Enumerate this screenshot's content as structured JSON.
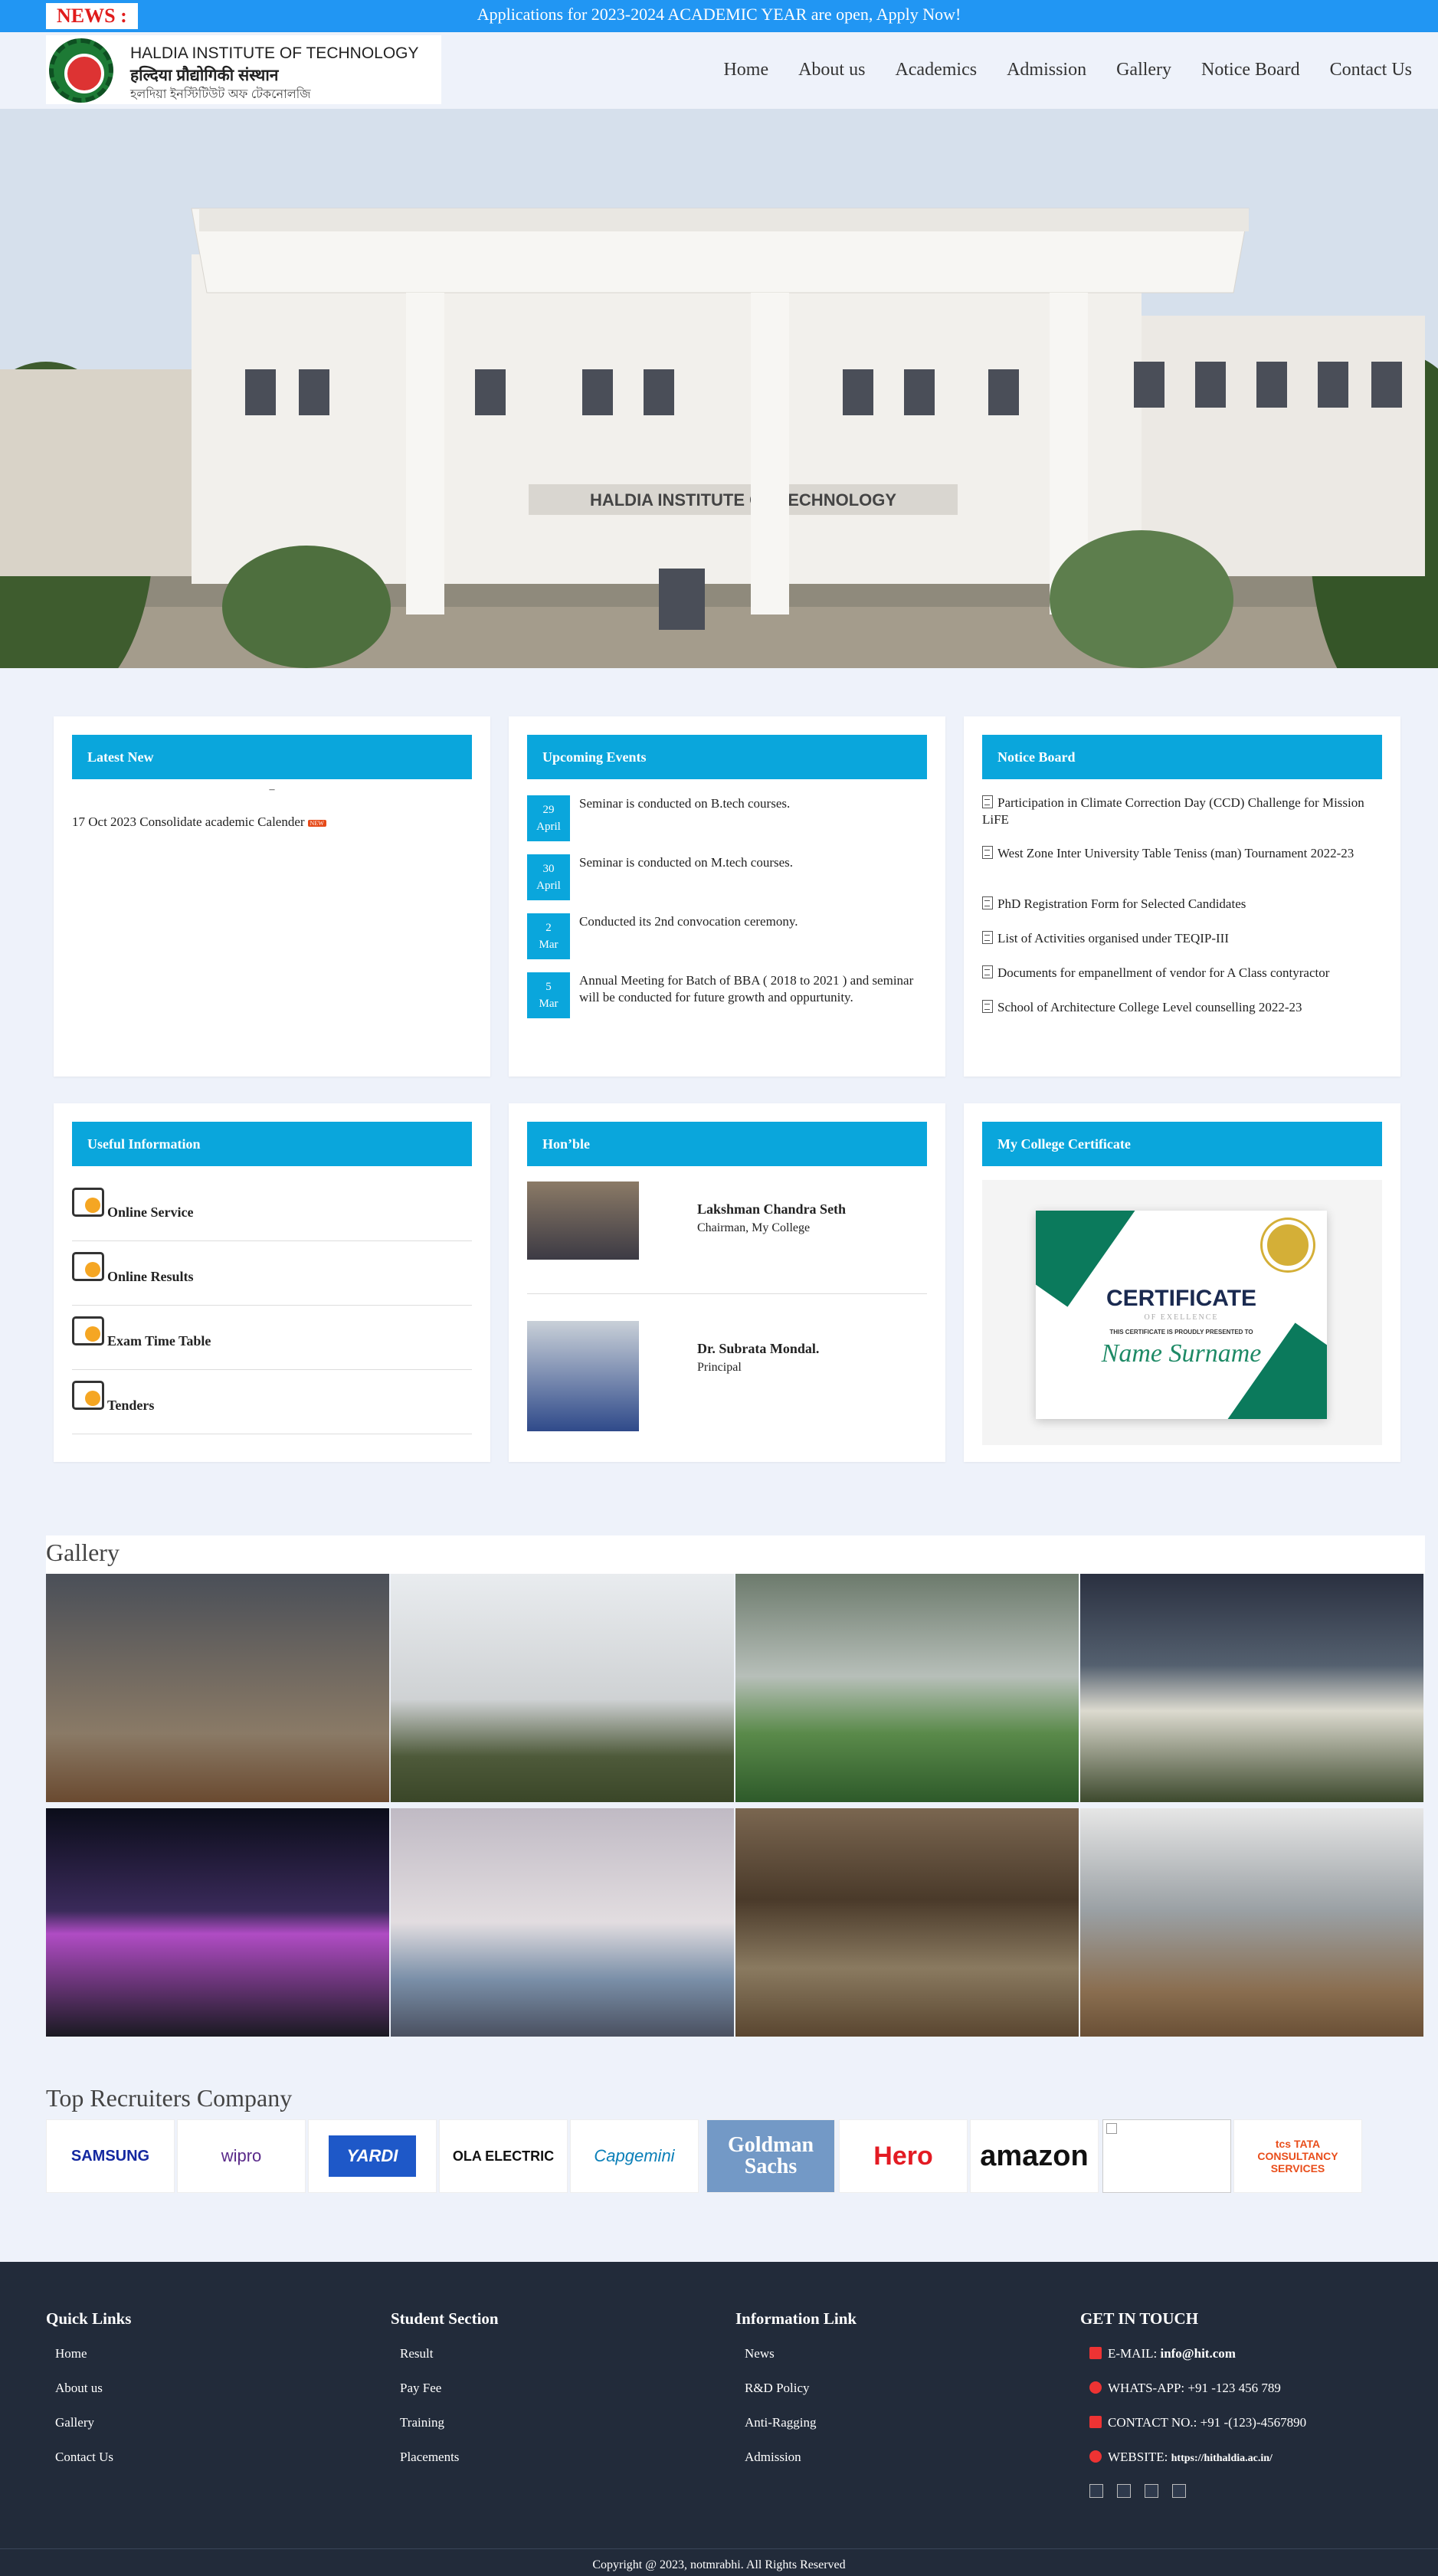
{
  "newsbar": {
    "label": "NEWS :",
    "text": "Applications for 2023-2024 ACADEMIC YEAR are open, Apply Now!"
  },
  "logo": {
    "line1": "HALDIA INSTITUTE OF TECHNOLOGY",
    "line2": "हल्दिया प्रौद्योगिकी संस्थान",
    "line3": "হলদিয়া ইনস্টিটিউট অফ টেকনোলজি"
  },
  "nav": [
    "Home",
    "About us",
    "Academics",
    "Admission",
    "Gallery",
    "Notice Board",
    "Contact Us"
  ],
  "hero": {
    "building_sign": "HALDIA INSTITUTE OF TECHNOLOGY"
  },
  "latest_news": {
    "title": "Latest New",
    "separator": "–",
    "item": "17 Oct 2023 Consolidate academic Calender",
    "badge": "NEW"
  },
  "upcoming_events": {
    "title": "Upcoming Events",
    "items": [
      {
        "day": "29",
        "month": "April",
        "text": "Seminar is conducted on B.tech courses."
      },
      {
        "day": "30",
        "month": "April",
        "text": "Seminar is conducted on M.tech courses."
      },
      {
        "day": "2",
        "month": "Mar",
        "text": "Conducted its 2nd convocation ceremony."
      },
      {
        "day": "5",
        "month": "Mar",
        "text": "Annual Meeting for Batch of BBA ( 2018 to 2021 ) and seminar will be conducted for future growth and oppurtunity."
      }
    ]
  },
  "notice_board": {
    "title": "Notice Board",
    "items": [
      "Participation in Climate Correction Day (CCD) Challenge for Mission LiFE",
      "West Zone Inter University Table Teniss (man) Tournament 2022-23",
      "PhD Registration Form for Selected Candidates",
      "List of Activities organised under TEQIP-III",
      "Documents for empanellment of vendor for A Class contyractor",
      "School of Architecture College Level counselling 2022-23"
    ]
  },
  "useful_info": {
    "title": "Useful Information",
    "items": [
      "Online Service",
      "Online Results",
      "Exam Time Table",
      "Tenders"
    ]
  },
  "honble": {
    "title": "Hon’ble",
    "people": [
      {
        "name": "Lakshman Chandra Seth",
        "role": "Chairman, My College"
      },
      {
        "name": "Dr. Subrata Mondal.",
        "role": "Principal"
      }
    ]
  },
  "certificate": {
    "title": "My College Certificate",
    "cert_title": "CERTIFICATE",
    "cert_sub": "OF EXELLENCE",
    "cert_presented": "THIS CERTIFICATE IS PROUDLY PRESENTED TO",
    "cert_name": "Name Surname"
  },
  "gallery": {
    "title": "Gallery"
  },
  "recruiters": {
    "title": "Top Recruiters Company",
    "items": [
      "SAMSUNG",
      "wipro",
      "YARDI",
      "OLA ELECTRIC",
      "Capgemini",
      "Goldman Sachs",
      "Hero",
      "amazon",
      "",
      "tcs TATA CONSULTANCY SERVICES"
    ]
  },
  "footer": {
    "quick_links": {
      "title": "Quick Links",
      "items": [
        "Home",
        "About us",
        "Gallery",
        "Contact Us"
      ]
    },
    "student_section": {
      "title": "Student Section",
      "items": [
        "Result",
        "Pay Fee",
        "Training",
        "Placements"
      ]
    },
    "information_link": {
      "title": "Information Link",
      "items": [
        "News",
        "R&D Policy",
        "Anti-Ragging",
        "Admission"
      ]
    },
    "contact": {
      "title": "GET IN TOUCH",
      "email_label": "E-MAIL:",
      "email": "info@hit.com",
      "whatsapp_label": "WHATS-APP:",
      "whatsapp": "+91 -123 456 789",
      "contact_label": "CONTACT NO.:",
      "contact": "+91 -(123)-4567890",
      "website_label": "WEBSITE:",
      "website": "https://hithaldia.ac.in/"
    },
    "copyright": "Copyright @ 2023, notmrabhi. All Rights Reserved"
  },
  "colors": {
    "newsbar": "#2196f3",
    "card_header": "#0aa6dc",
    "footer_bg": "#222b3a",
    "news_label": "#e01b1b"
  }
}
